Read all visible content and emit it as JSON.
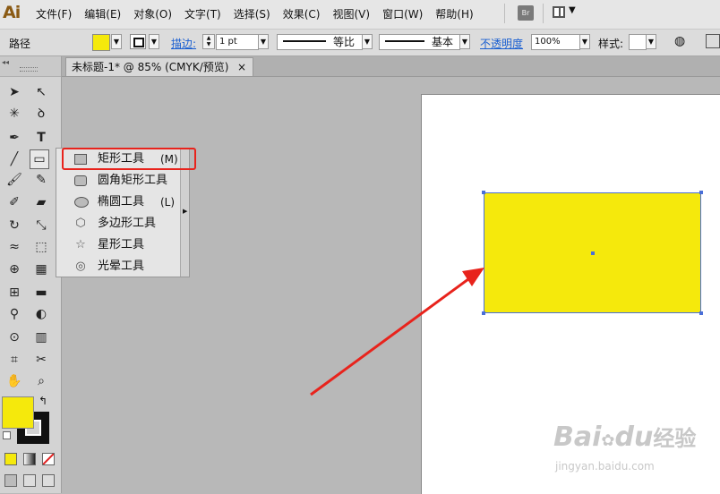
{
  "app": {
    "logo": "Ai"
  },
  "menubar": {
    "items": [
      "文件(F)",
      "编辑(E)",
      "对象(O)",
      "文字(T)",
      "选择(S)",
      "效果(C)",
      "视图(V)",
      "窗口(W)",
      "帮助(H)"
    ],
    "bridge_label": "Br"
  },
  "controlbar": {
    "selection_type": "路径",
    "fill_color": "#f5e90c",
    "stroke_label": "描边:",
    "stroke_weight": "1 pt",
    "stroke_profile": "等比",
    "brush_label": "基本",
    "opacity_label": "不透明度",
    "opacity_value": "100%",
    "style_label": "样式:"
  },
  "document_tab": {
    "title": "未标题-1* @ 85% (CMYK/预览)",
    "close": "×"
  },
  "tool_flyout": {
    "items": [
      {
        "icon": "rectangle-icon",
        "label": "矩形工具",
        "shortcut": "(M)"
      },
      {
        "icon": "rounded-rectangle-icon",
        "label": "圆角矩形工具",
        "shortcut": ""
      },
      {
        "icon": "ellipse-icon",
        "label": "椭圆工具",
        "shortcut": "(L)"
      },
      {
        "icon": "polygon-icon",
        "label": "多边形工具",
        "shortcut": ""
      },
      {
        "icon": "star-icon",
        "label": "星形工具",
        "shortcut": ""
      },
      {
        "icon": "flare-icon",
        "label": "光晕工具",
        "shortcut": ""
      }
    ]
  },
  "canvas": {
    "shape_fill": "#f5e90c",
    "selection_color": "#4a6fd8",
    "annotation_color": "#e8231c"
  },
  "watermark": {
    "brand": "Bai",
    "brand2": "du",
    "text": "经验",
    "url": "jingyan.baidu.com"
  }
}
